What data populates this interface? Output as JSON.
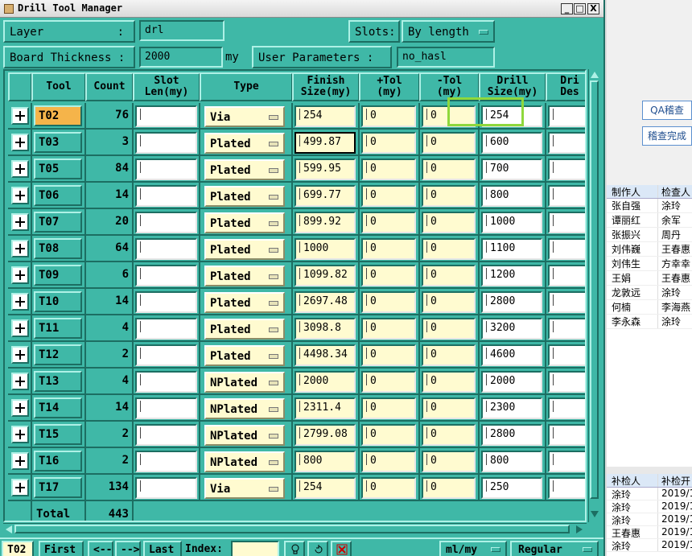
{
  "window": {
    "title": "Drill Tool Manager",
    "buttons": [
      "_",
      "□",
      "X"
    ]
  },
  "header": {
    "layer_label": "Layer",
    "layer_colon": ":",
    "layer_value": "drl",
    "slots_label": "Slots:",
    "slots_value": "By length",
    "board_thickness_label": "Board Thickness :",
    "board_thickness_value": "2000",
    "board_thickness_unit": "my",
    "user_params_label": "User Parameters :",
    "user_params_value": "no_hasl"
  },
  "table": {
    "columns": [
      "Tool",
      "Count",
      "Slot\nLen(my)",
      "Type",
      "Finish\nSize(my)",
      "+Tol\n(my)",
      "-Tol\n(my)",
      "Drill\nSize(my)",
      "Dri\nDes"
    ],
    "rows": [
      {
        "tool": "T02",
        "count": "76",
        "slot": "",
        "type": "Via",
        "finish": "254",
        "ptol": "0",
        "mtol": "0",
        "drill": "254",
        "selected": true
      },
      {
        "tool": "T03",
        "count": "3",
        "slot": "",
        "type": "Plated",
        "finish": "499.87",
        "ptol": "0",
        "mtol": "0",
        "drill": "600",
        "selected": false
      },
      {
        "tool": "T05",
        "count": "84",
        "slot": "",
        "type": "Plated",
        "finish": "599.95",
        "ptol": "0",
        "mtol": "0",
        "drill": "700",
        "selected": false
      },
      {
        "tool": "T06",
        "count": "14",
        "slot": "",
        "type": "Plated",
        "finish": "699.77",
        "ptol": "0",
        "mtol": "0",
        "drill": "800",
        "selected": false
      },
      {
        "tool": "T07",
        "count": "20",
        "slot": "",
        "type": "Plated",
        "finish": "899.92",
        "ptol": "0",
        "mtol": "0",
        "drill": "1000",
        "selected": false
      },
      {
        "tool": "T08",
        "count": "64",
        "slot": "",
        "type": "Plated",
        "finish": "1000",
        "ptol": "0",
        "mtol": "0",
        "drill": "1100",
        "selected": false
      },
      {
        "tool": "T09",
        "count": "6",
        "slot": "",
        "type": "Plated",
        "finish": "1099.82",
        "ptol": "0",
        "mtol": "0",
        "drill": "1200",
        "selected": false
      },
      {
        "tool": "T10",
        "count": "14",
        "slot": "",
        "type": "Plated",
        "finish": "2697.48",
        "ptol": "0",
        "mtol": "0",
        "drill": "2800",
        "selected": false
      },
      {
        "tool": "T11",
        "count": "4",
        "slot": "",
        "type": "Plated",
        "finish": "3098.8",
        "ptol": "0",
        "mtol": "0",
        "drill": "3200",
        "selected": false
      },
      {
        "tool": "T12",
        "count": "2",
        "slot": "",
        "type": "Plated",
        "finish": "4498.34",
        "ptol": "0",
        "mtol": "0",
        "drill": "4600",
        "selected": false
      },
      {
        "tool": "T13",
        "count": "4",
        "slot": "",
        "type": "NPlated",
        "finish": "2000",
        "ptol": "0",
        "mtol": "0",
        "drill": "2000",
        "selected": false
      },
      {
        "tool": "T14",
        "count": "14",
        "slot": "",
        "type": "NPlated",
        "finish": "2311.4",
        "ptol": "0",
        "mtol": "0",
        "drill": "2300",
        "selected": false
      },
      {
        "tool": "T15",
        "count": "2",
        "slot": "",
        "type": "NPlated",
        "finish": "2799.08",
        "ptol": "0",
        "mtol": "0",
        "drill": "2800",
        "selected": false
      },
      {
        "tool": "T16",
        "count": "2",
        "slot": "",
        "type": "NPlated",
        "finish": "800",
        "ptol": "0",
        "mtol": "0",
        "drill": "800",
        "selected": false
      },
      {
        "tool": "T17",
        "count": "134",
        "slot": "",
        "type": "Via",
        "finish": "254",
        "ptol": "0",
        "mtol": "0",
        "drill": "250",
        "selected": false
      }
    ],
    "total_label": "Total",
    "total_count": "443"
  },
  "bottom": {
    "current_tool": "T02",
    "first": "First",
    "prev": "<--",
    "next": "-->",
    "last": "Last",
    "index_label": "Index:",
    "unit_value": "ml/my",
    "mode_value": "Regular"
  },
  "right_panel": {
    "qa_button": "QA稽查",
    "check_done_button": "稽查完成",
    "table1_headers": [
      "制作人",
      "检查人"
    ],
    "table1_rows": [
      [
        "张自强",
        "涂玲"
      ],
      [
        "谭丽红",
        "余军"
      ],
      [
        "张振兴",
        "周丹"
      ],
      [
        "刘伟巍",
        "王春惠"
      ],
      [
        "刘伟生",
        "方幸幸"
      ],
      [
        "王娟",
        "王春惠"
      ],
      [
        "龙敦远",
        "涂玲"
      ],
      [
        "何楠",
        "李海燕"
      ],
      [
        "李永森",
        "涂玲"
      ]
    ],
    "table2_headers": [
      "补检人",
      "补检开"
    ],
    "table2_rows": [
      [
        "涂玲",
        "2019/1"
      ],
      [
        "涂玲",
        "2019/1"
      ],
      [
        "涂玲",
        "2019/1"
      ],
      [
        "王春惠",
        "2019/1"
      ],
      [
        "涂玲",
        "2019/1"
      ]
    ]
  },
  "colors": {
    "panel": "#3fb8a7",
    "selected_tool": "#f5b44a",
    "yellow_field": "#fffbd0",
    "highlight": "#8fd83c"
  }
}
